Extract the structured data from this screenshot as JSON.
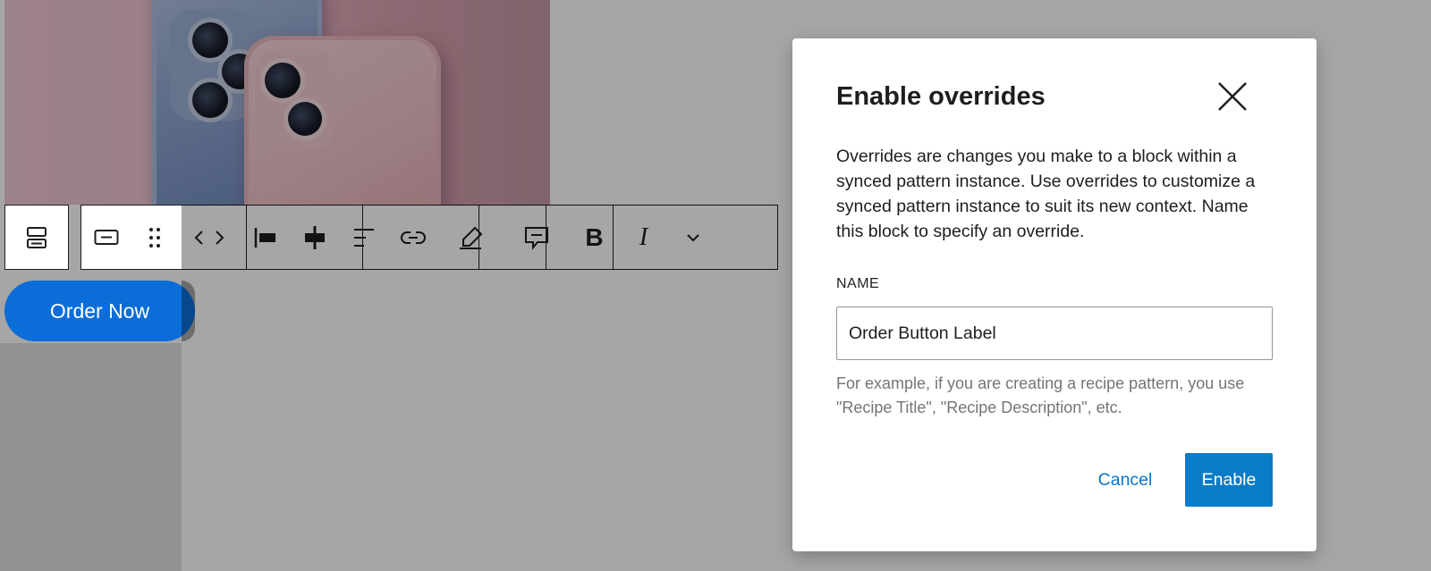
{
  "canvas": {
    "product_image": "iPhone product photo",
    "order_button_label": "Order Now"
  },
  "toolbar": {
    "groups": [
      {
        "name": "block-type",
        "icons": [
          "layout-grid-icon"
        ]
      },
      {
        "name": "block-controls",
        "icons": [
          "button-icon",
          "drag-handle-icon",
          "move-arrows-icon"
        ]
      },
      {
        "name": "align",
        "icons": [
          "justify-left-icon",
          "justify-center-icon"
        ]
      },
      {
        "name": "text",
        "icons": [
          "align-text-icon",
          "link-icon"
        ]
      },
      {
        "name": "highlight",
        "icons": [
          "highlighter-icon"
        ]
      },
      {
        "name": "comment",
        "icons": [
          "comment-icon"
        ]
      },
      {
        "name": "formatting",
        "icons": [
          "bold-icon",
          "italic-icon",
          "chevron-down-icon"
        ]
      }
    ]
  },
  "modal": {
    "title": "Enable overrides",
    "description": "Overrides are changes you make to a block within a synced pattern instance. Use overrides to customize a synced pattern instance to suit its new context. Name this block to specify an override.",
    "name_label": "NAME",
    "name_value": "Order Button Label",
    "help_text": "For example, if you are creating a recipe pattern, you use \"Recipe Title\", \"Recipe Description\", etc.",
    "cancel_label": "Cancel",
    "enable_label": "Enable"
  },
  "colors": {
    "accent": "#0a7cc6",
    "order_button": "#0b6dd8",
    "text": "#1e1e1e",
    "help_text": "#757575"
  }
}
